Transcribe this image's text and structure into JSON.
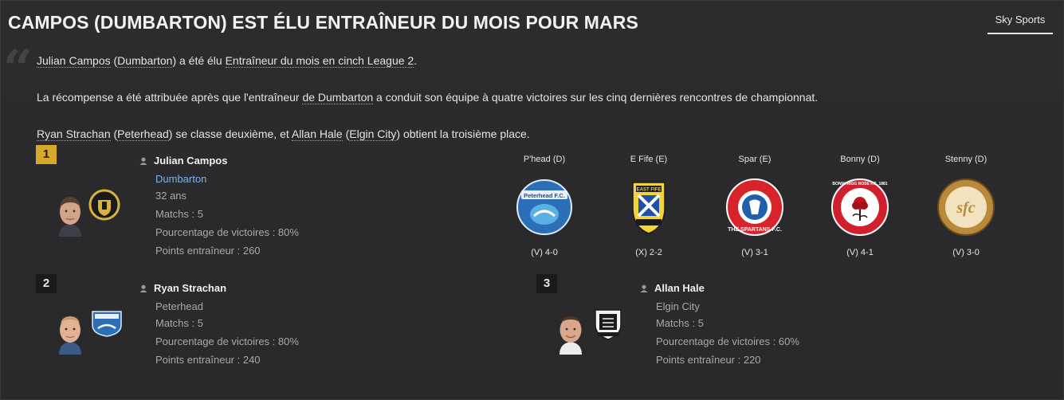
{
  "header": {
    "title": "CAMPOS (DUMBARTON) EST ÉLU ENTRAÎNEUR DU MOIS POUR MARS",
    "source_tab": "Sky Sports"
  },
  "article": {
    "p1": {
      "name": "Julian Campos",
      "open": " (",
      "club": "Dumbarton",
      "mid": ") a été élu ",
      "award": "Entraîneur du mois en cinch League 2",
      "end": "."
    },
    "p2": {
      "start": "La récompense a été attribuée après que l'entraîneur ",
      "club": "de Dumbarton",
      "end": " a conduit son équipe à quatre victoires sur les cinq dernières rencontres de championnat."
    },
    "p3": {
      "name2": "Ryan Strachan",
      "open2": " (",
      "club2": "Peterhead",
      "mid": ") se classe deuxième, et ",
      "name3": "Allan Hale",
      "open3": " (",
      "club3": "Elgin City",
      "end": ") obtient la troisième place."
    }
  },
  "winners": [
    {
      "rank": "1",
      "name": "Julian Campos",
      "club": "Dumbarton",
      "age": "32 ans",
      "matches": "Matchs : 5",
      "win_pct": "Pourcentage de victoires : 80%",
      "points": "Points entraîneur : 260"
    },
    {
      "rank": "2",
      "name": "Ryan Strachan",
      "club": "Peterhead",
      "matches": "Matchs : 5",
      "win_pct": "Pourcentage de victoires : 80%",
      "points": "Points entraîneur : 240"
    },
    {
      "rank": "3",
      "name": "Allan Hale",
      "club": "Elgin City",
      "matches": "Matchs : 5",
      "win_pct": "Pourcentage de victoires : 60%",
      "points": "Points entraîneur : 220"
    }
  ],
  "results": [
    {
      "team": "P'head (D)",
      "result": "(V) 4-0",
      "crest_text": "Peterhead F.C."
    },
    {
      "team": "E Fife (E)",
      "result": "(X) 2-2",
      "crest_text": "EAST FIFE"
    },
    {
      "team": "Spar (E)",
      "result": "(V) 3-1",
      "crest_text": "THE SPARTANS F.C."
    },
    {
      "team": "Bonny (D)",
      "result": "(V) 4-1",
      "crest_text": "BONNYRIGG ROSE F.C. 1881"
    },
    {
      "team": "Stenny (D)",
      "result": "(V) 3-0",
      "crest_text": "sfc"
    }
  ],
  "colors": {
    "background": "#2a2a2c",
    "rank1": "#d7a92a",
    "link": "#7fb0e8",
    "muted_text": "#a9a9ab"
  }
}
